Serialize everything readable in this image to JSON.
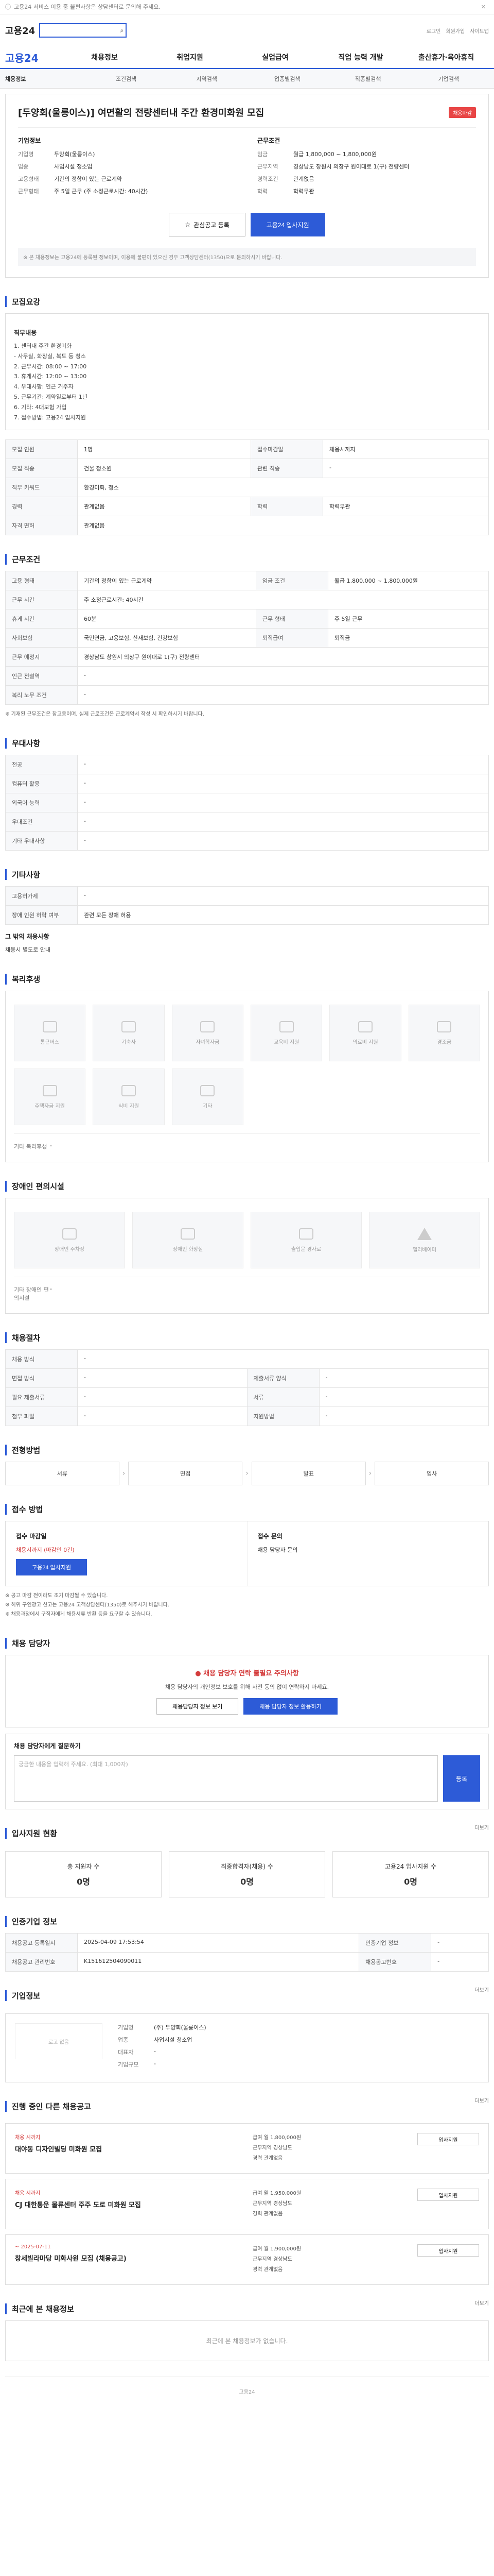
{
  "top_notice": "고용24 서비스 이용 중 불편사항은 상담센터로 문의해 주세요.",
  "header": {
    "logo": "고용24",
    "util": [
      "로그인",
      "회원가입",
      "사이트맵"
    ],
    "gnb": [
      "채용정보",
      "취업지원",
      "실업급여",
      "직업 능력 개발",
      "출산휴가·육아휴직"
    ],
    "subnav": [
      "채용정보",
      "조건검색",
      "지역검색",
      "업종별검색",
      "직종별검색",
      "기업검색"
    ]
  },
  "job": {
    "badge": "채용마감",
    "title": "[두양회(울릉이스)] 여면활의 전량센터내 주간 환경미화원 모집",
    "company_label": "기업정보",
    "company_rows": [
      {
        "k": "기업명",
        "v": "두양회(울릉이스)"
      },
      {
        "k": "업종",
        "v": "사업시설 청소업"
      },
      {
        "k": "고용형태",
        "v": "기간의 정함이 있는 근로계약"
      },
      {
        "k": "근무형태",
        "v": "주 5일 근무 (주 소정근로시간: 40시간)"
      }
    ],
    "terms_label": "근무조건",
    "terms_rows": [
      {
        "k": "임금",
        "v": "월급 1,800,000 ~ 1,800,000원"
      },
      {
        "k": "근무지역",
        "v": "경상남도 창원시 의창구 원이대로 1(구) 전량센터"
      },
      {
        "k": "경력조건",
        "v": "관계없음"
      },
      {
        "k": "학력",
        "v": "학력무관"
      }
    ],
    "btn_interest": "관심공고 등록",
    "btn_apply": "고용24 입사지원",
    "notice": "※ 본 채용정보는 고용24에 등록된 정보이며, 이용에 불편이 있으신 경우 고객상담센터(1350)으로 문의하시기 바랍니다."
  },
  "sections": {
    "desc_title": "모집요강",
    "desc_subtitle": "직무내용",
    "desc_text": "1. 센터내 주간 환경미화\n - 사무실, 화장실, 복도 등 청소\n2. 근무시간: 08:00 ~ 17:00\n3. 휴게시간: 12:00 ~ 13:00\n4. 우대사항: 인근 거주자\n5. 근무기간: 계약일로부터 1년\n6. 기타: 4대보험 가입\n7. 접수방법: 고용24 입사지원",
    "recruit_title": "모집요강 상세",
    "recruit_rows": [
      {
        "k": "모집 인원",
        "v": "1명",
        "k2": "접수마감일",
        "v2": "채용시까지"
      },
      {
        "k": "모집 직종",
        "v": "건물 청소원",
        "k2": "관련 직종",
        "v2": "-"
      },
      {
        "k": "직무 키워드",
        "v": "환경미화, 청소",
        "k2": "",
        "v2": ""
      },
      {
        "k": "경력",
        "v": "관계없음",
        "k2": "학력",
        "v2": "학력무관"
      },
      {
        "k": "자격 면허",
        "v": "관계없음",
        "k2": "",
        "v2": ""
      }
    ],
    "work_title": "근무조건",
    "work_rows": [
      {
        "k": "고용 형태",
        "v": "기간의 정함이 있는 근로계약",
        "k2": "임금 조건",
        "v2": "월급 1,800,000 ~ 1,800,000원"
      },
      {
        "k": "근무 시간",
        "v": "주 소정근로시간: 40시간",
        "k2": "",
        "v2": ""
      },
      {
        "k": "휴게 시간",
        "v": "60분",
        "k2": "근무 형태",
        "v2": "주 5일 근무"
      },
      {
        "k": "사회보험",
        "v": "국민연금, 고용보험, 산재보험, 건강보험",
        "k2": "퇴직급여",
        "v2": "퇴직금"
      },
      {
        "k": "근무 예정지",
        "v": "경상남도 창원시 의창구 원이대로 1(구) 전량센터",
        "k2": "",
        "v2": ""
      },
      {
        "k": "인근 전철역",
        "v": "-",
        "k2": "",
        "v2": ""
      },
      {
        "k": "복리 노무 조건",
        "v": "-",
        "k2": "",
        "v2": ""
      }
    ],
    "work_note": "※ 기재된 근무조건은 참고용이며, 실제 근로조건은 근로계약서 작성 시 확인하시기 바랍니다.",
    "pref_title": "우대사항",
    "pref_rows": [
      {
        "k": "전공",
        "v": "-"
      },
      {
        "k": "컴퓨터 활용",
        "v": "-"
      },
      {
        "k": "외국어 능력",
        "v": "-"
      },
      {
        "k": "우대조건",
        "v": "-"
      },
      {
        "k": "기타 우대사항",
        "v": "-"
      }
    ],
    "etc_title": "기타사항",
    "etc_rows": [
      {
        "k": "고용허가제",
        "v": "-"
      },
      {
        "k": "장애 인원 허락 여부",
        "v": "관련 모든 장애 허용"
      }
    ],
    "etc_sub": "그 밖의 채용사항",
    "etc_sub_text": "채용시 별도로 안내",
    "welfare_title": "복리후생",
    "welfare_items": [
      "통근버스",
      "기숙사",
      "자녀학자금",
      "교육비 지원",
      "의료비 지원",
      "경조금",
      "주택자금 지원",
      "식비 지원",
      "기타"
    ],
    "welfare_other_label": "기타 복리후생",
    "welfare_other_value": "-",
    "disabled_title": "장애인 편의시설",
    "disabled_items": [
      "장애인 주차장",
      "장애인 화장실",
      "출입문 경사로",
      "엘리베이터"
    ],
    "disabled_other_label": "기타 장애인 편의시설",
    "disabled_other_value": "-",
    "process_title": "채용절차",
    "process_rows": [
      {
        "k": "채용 방식",
        "v": "-",
        "k2": "",
        "v2": ""
      },
      {
        "k": "면접 방식",
        "v": "-",
        "k2": "제출서류 양식",
        "v2": "-"
      },
      {
        "k": "필요 제출서류",
        "v": "-",
        "k2": "서류",
        "v2": "-"
      },
      {
        "k": "첨부 파일",
        "v": "-",
        "k2": "지원방법",
        "v2": "-"
      }
    ],
    "steps_title": "전형방법",
    "steps": [
      "서류",
      "면접",
      "발표",
      "입사"
    ],
    "apply_title": "접수 방법",
    "apply_deadline_label": "접수 마감일",
    "apply_deadline": "채용시까지 (마감인 0건)",
    "apply_btn": "고용24 입사지원",
    "apply_contact_label": "접수 문의",
    "apply_contact": "채용 담당자 문의",
    "apply_bullets": [
      "※ 공고 마감 전이라도 조기 마감될 수 있습니다.",
      "※ 허위 구인광고 신고는 고용24 고객상담센터(1350)로 해주시기 바랍니다.",
      "※ 채용과정에서 구직자에게 채용서류 반환 등을 요구할 수 있습니다."
    ],
    "qna_title": "채용 담당자",
    "qna_warn": "채용 담당자 연락 불필요 주의사항",
    "qna_text": "채용 담당자의 개인정보 보호를 위해 사전 동의 없이 연락하지 마세요.",
    "qna_btn_a": "채용담당자 정보 보기",
    "qna_btn_b": "채용 담당자 정보 활용하기",
    "qna_form_label": "채용 담당자에게 질문하기",
    "qna_placeholder": "궁금한 내용을 입력해 주세요. (최대 1,000자)",
    "qna_send": "등록",
    "applicants_title": "입사지원 현황",
    "applicants": [
      {
        "label": "총 지원자 수",
        "n": "0명"
      },
      {
        "label": "최종합격자(채용) 수",
        "n": "0명"
      },
      {
        "label": "고용24 입사지원 수",
        "n": "0명"
      }
    ],
    "info_title": "인증기업 정보",
    "info_rows": [
      {
        "k": "채용공고 등록일시",
        "v": "2025-04-09 17:53:54",
        "k2": "인증기업 정보",
        "v2": "-"
      },
      {
        "k": "채용공고 관리번호",
        "v": "K151612504090011",
        "k2": "채용공고번호",
        "v2": "-"
      }
    ],
    "company_title": "기업정보",
    "company_logo": "로고 없음",
    "company_rows": [
      {
        "k": "기업명",
        "v": "(주) 두양회(울릉이스)"
      },
      {
        "k": "업종",
        "v": "사업시설 청소업"
      },
      {
        "k": "대표자",
        "v": "-"
      },
      {
        "k": "기업규모",
        "v": "-"
      }
    ],
    "related_title": "진행 중인 다른 채용공고",
    "related": [
      {
        "tag": "채용 시까지",
        "title": "대야동 디자인빌딩 미화원 모집",
        "meta": [
          "급여 월 1,800,000원",
          "근무지역 경상남도",
          "경력 관계없음"
        ],
        "btn": "입사지원"
      },
      {
        "tag": "채용 시까지",
        "title": "CJ 대한통운 물류센터 주주 도로 미화원 모집",
        "meta": [
          "급여 월 1,950,000원",
          "근무지역 경상남도",
          "경력 관계없음"
        ],
        "btn": "입사지원"
      },
      {
        "tag": "~ 2025-07-11",
        "title": "창세빌라마당 미화사원 모집 (채용공고)",
        "meta": [
          "급여 월 1,900,000원",
          "근무지역 경상남도",
          "경력 관계없음"
        ],
        "btn": "입사지원"
      }
    ],
    "recent_title": "최근에 본 채용정보",
    "recent_text": "최근에 본 채용정보가 없습니다.",
    "more": "더보기"
  }
}
